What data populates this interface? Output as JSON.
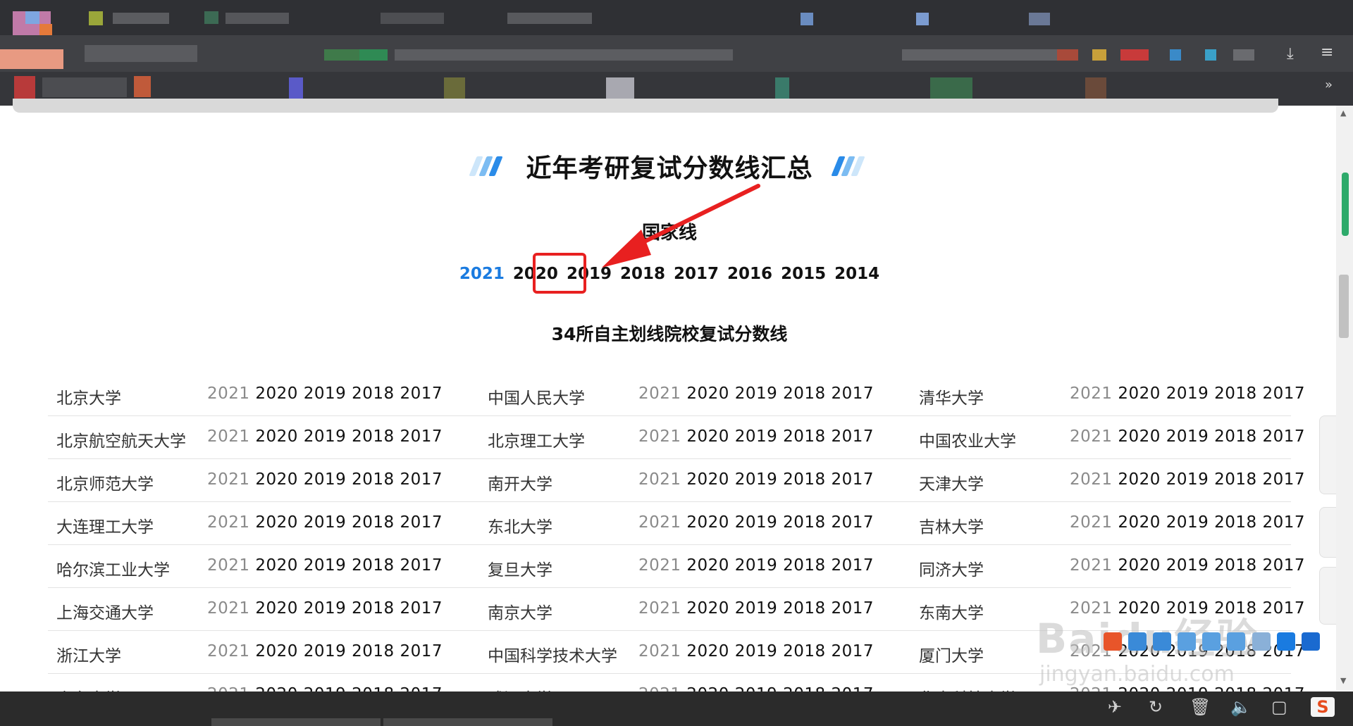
{
  "page": {
    "title": "近年考研复试分数线汇总",
    "national_line": {
      "heading": "国家线",
      "years": [
        "2021",
        "2020",
        "2019",
        "2018",
        "2017",
        "2016",
        "2015",
        "2014"
      ],
      "active_year": "2021",
      "highlighted_year": "2020"
    },
    "self_line": {
      "heading": "34所自主划线院校复试分数线"
    },
    "school_years": [
      "2021",
      "2020",
      "2019",
      "2018",
      "2017"
    ],
    "schools": [
      [
        "北京大学",
        "中国人民大学",
        "清华大学"
      ],
      [
        "北京航空航天大学",
        "北京理工大学",
        "中国农业大学"
      ],
      [
        "北京师范大学",
        "南开大学",
        "天津大学"
      ],
      [
        "大连理工大学",
        "东北大学",
        "吉林大学"
      ],
      [
        "哈尔滨工业大学",
        "复旦大学",
        "同济大学"
      ],
      [
        "上海交通大学",
        "南京大学",
        "东南大学"
      ],
      [
        "浙江大学",
        "中国科学技术大学",
        "厦门大学"
      ],
      [
        "山东大学",
        "武汉大学",
        "华中科技大学"
      ]
    ]
  },
  "watermark": {
    "main": "Baidu经验",
    "sub": "jingyan.baidu.com"
  },
  "colors": {
    "active_year": "#1a7be0",
    "annotation_red": "#e82020",
    "muted_year": "#8a8a8a",
    "slash_light": "#a9d4f5",
    "slash_dark": "#2a8be8"
  },
  "icons": {
    "arrow": "red-arrow-icon",
    "ime": "sogou-ime-icon"
  },
  "taskbar": {
    "ime_label": "S"
  }
}
